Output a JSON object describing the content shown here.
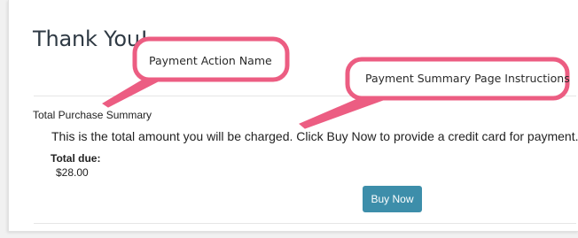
{
  "page": {
    "title": "Thank You!"
  },
  "summary": {
    "section_title": "Total Purchase Summary",
    "instructions": "This is the total amount you will be charged. Click Buy Now to provide a credit card for payment.",
    "total_label": "Total due:",
    "total_value": "$28.00",
    "buy_button_label": "Buy Now"
  },
  "callouts": {
    "payment_action_name": "Payment Action Name",
    "payment_summary_instructions": "Payment Summary Page Instructions",
    "color": "#ec5d82"
  },
  "colors": {
    "button": "#3d8eaa",
    "title": "#2f3a44"
  }
}
